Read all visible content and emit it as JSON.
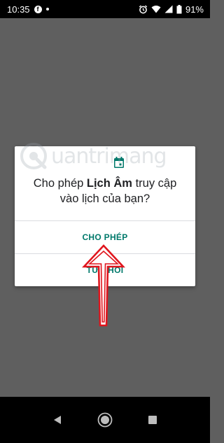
{
  "status_bar": {
    "time": "10:35",
    "notification_icons": [
      "facebook-icon",
      "dot-icon"
    ],
    "battery_percent": "91%",
    "system_icons": [
      "alarm-icon",
      "wifi-icon",
      "signal-icon",
      "battery-icon"
    ]
  },
  "dialog": {
    "icon": "calendar-icon",
    "message_prefix": "Cho phép ",
    "app_name": "Lịch Âm",
    "message_suffix": " truy cập",
    "message_line2": "vào lịch của bạn?",
    "allow_label": "CHO PHÉP",
    "deny_label": "TỪ CHỐI"
  },
  "watermark": {
    "text": "uantrimang"
  },
  "nav_bar": {
    "buttons": [
      "back-icon",
      "home-icon",
      "recents-icon"
    ]
  },
  "colors": {
    "accent": "#00796b",
    "scrim": "#5f5f5f",
    "arrow": "#e0151d"
  }
}
